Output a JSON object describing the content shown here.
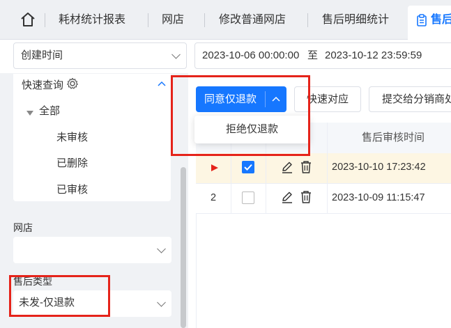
{
  "tabs": {
    "home_icon": "home-icon",
    "items": [
      "耗材统计报表",
      "网店",
      "修改普通网店",
      "售后明细统计"
    ],
    "active_label": "售后",
    "active_icon": "clipboard-icon"
  },
  "filters": {
    "time_field": "创建时间",
    "date_start": "2023-10-06 00:00:00",
    "date_sep": "至",
    "date_end": "2023-10-12 23:59:59"
  },
  "quick_query": {
    "title": "快速查询",
    "root": "全部",
    "children": [
      "未审核",
      "已删除",
      "已审核"
    ]
  },
  "shop_filter": {
    "label": "网店",
    "value": ""
  },
  "aftersale_type": {
    "label": "售后类型",
    "value": "未发-仅退款"
  },
  "toolbar": {
    "primary_button": "同意仅退款",
    "dropdown_item": "拒绝仅退款",
    "quick_button": "快速对应",
    "submit_button": "提交给分销商处"
  },
  "table": {
    "header_review_time": "售后审核时间",
    "rows": [
      {
        "index": "",
        "current": true,
        "checked": true,
        "time": "2023-10-10 17:23:42"
      },
      {
        "index": "2",
        "current": false,
        "checked": false,
        "time": "2023-10-09 11:15:47"
      }
    ]
  },
  "colors": {
    "accent": "#1677ff",
    "highlight": "#e5231a",
    "selected_row": "#fdf6e3"
  }
}
